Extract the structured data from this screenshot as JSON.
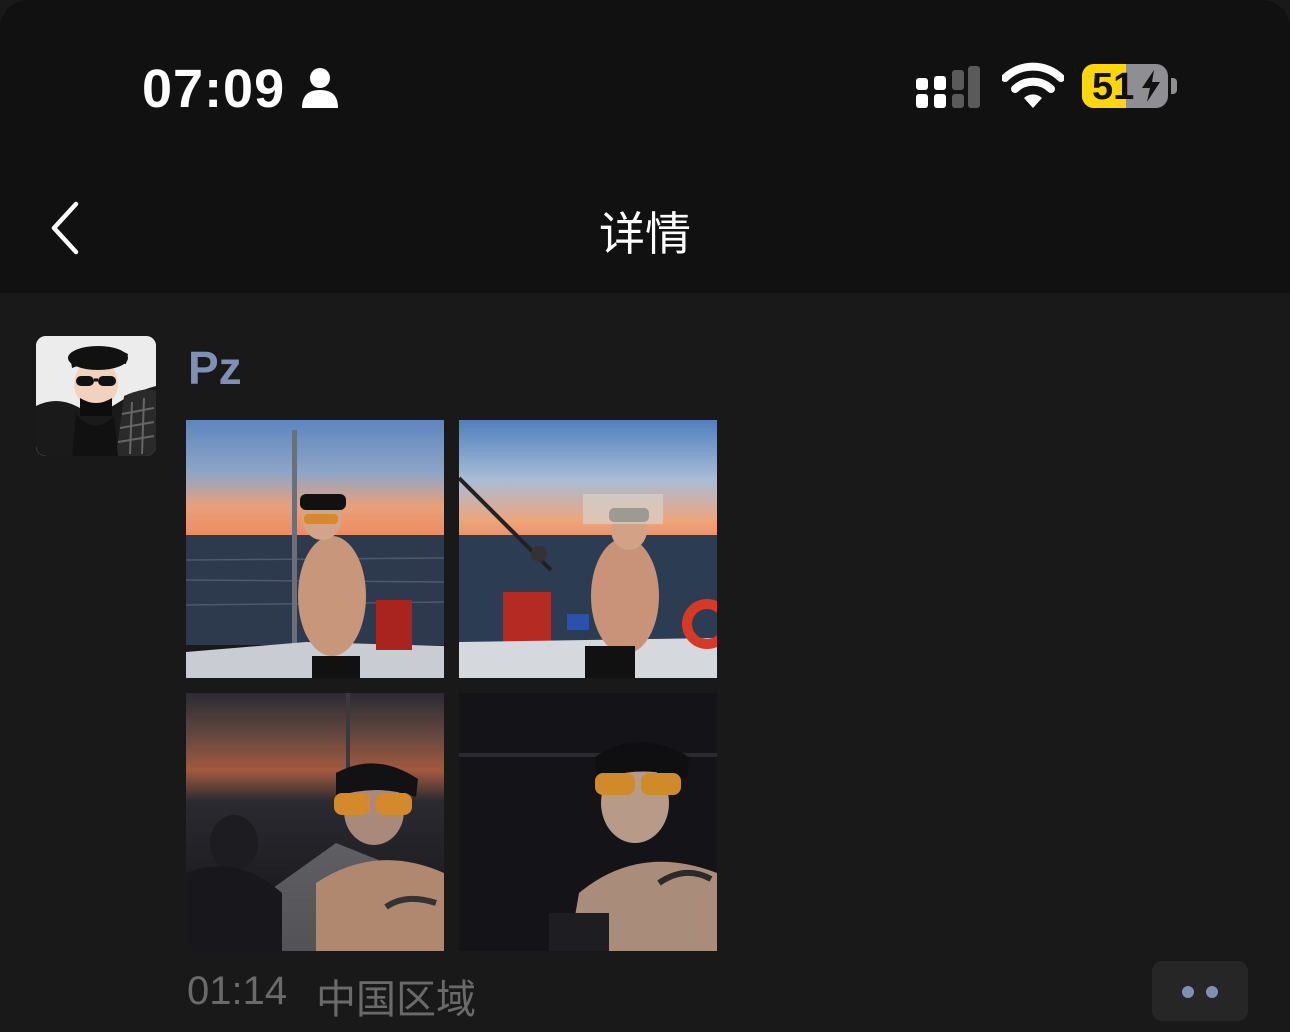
{
  "status_bar": {
    "time": "07:09",
    "battery_level": 51,
    "battery_text": "51",
    "charging": true,
    "icons": [
      "person-icon",
      "cellular-signal-icon",
      "wifi-icon",
      "battery-icon",
      "charging-bolt-icon"
    ],
    "colors": {
      "battery": "#ffd60a",
      "background": "#111111"
    }
  },
  "nav": {
    "title": "详情",
    "back_icon": "chevron-left-icon"
  },
  "post": {
    "author": "Pz",
    "avatar_icon": "avatar",
    "photos": [
      {
        "name": "photo-sunset-boat-1"
      },
      {
        "name": "photo-fishing-rod"
      },
      {
        "name": "photo-dusk-boat"
      },
      {
        "name": "photo-night-portrait"
      }
    ],
    "time": "01:14",
    "location": "中国区域",
    "more_icon": "more-dots-icon",
    "colors": {
      "author": "#7e90b4",
      "meta": "#6a6a6a"
    }
  }
}
